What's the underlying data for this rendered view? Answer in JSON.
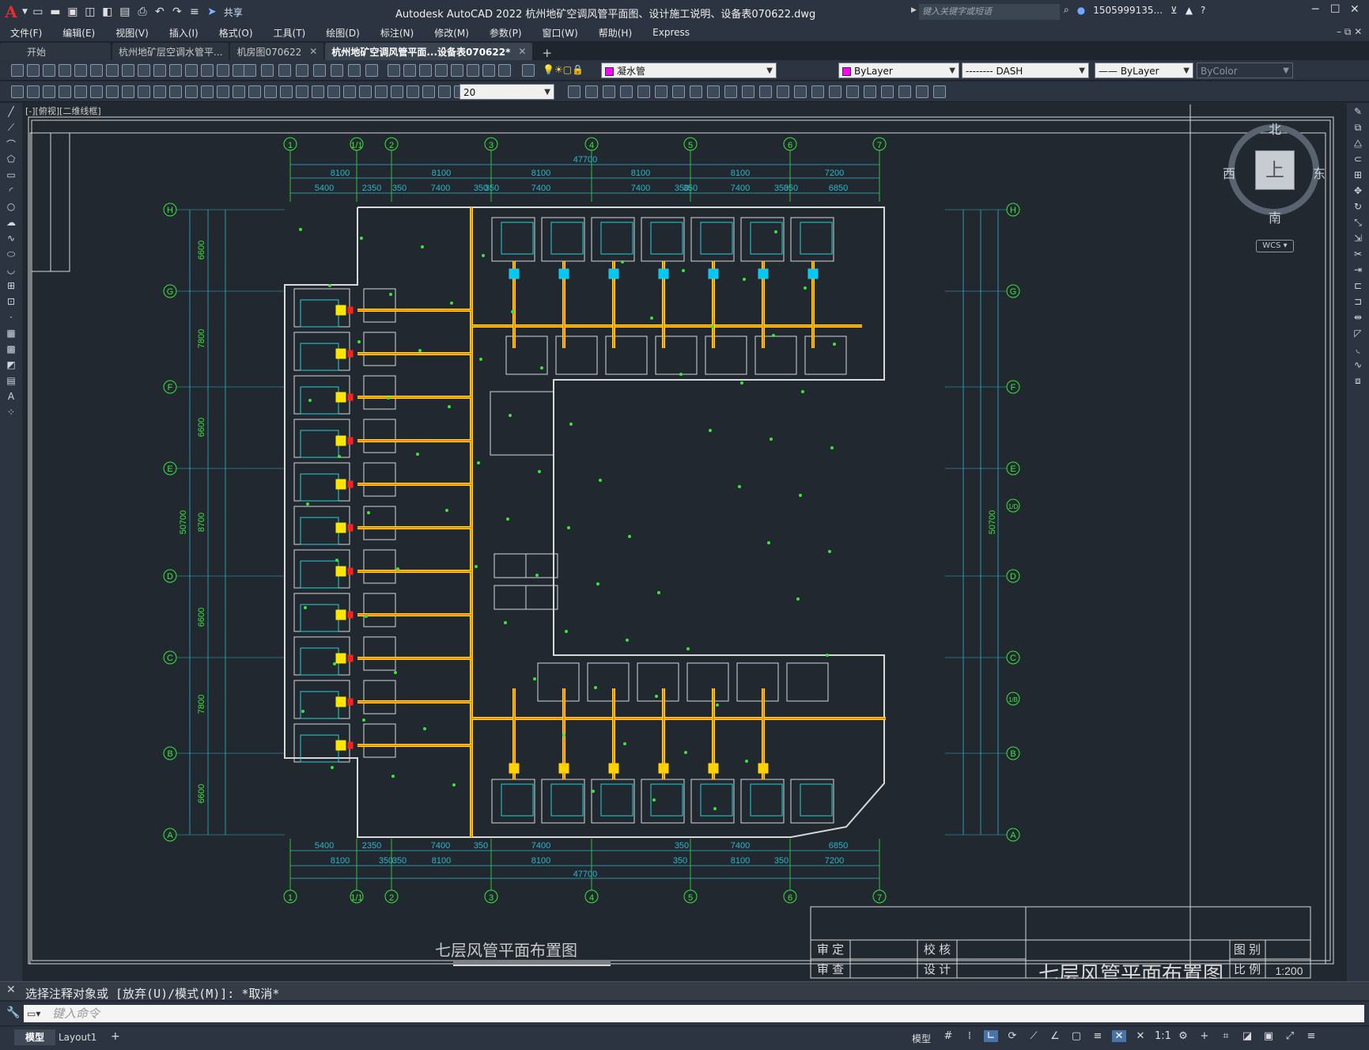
{
  "title_bar": {
    "app_title": "Autodesk AutoCAD 2022    杭州地矿空调风管平面图、设计施工说明、设备表070622.dwg",
    "share_label": "共享",
    "search_placeholder": "键入关键字或短语",
    "user": "1505999135...",
    "logo": "A"
  },
  "menu": [
    "文件(F)",
    "编辑(E)",
    "视图(V)",
    "插入(I)",
    "格式(O)",
    "工具(T)",
    "绘图(D)",
    "标注(N)",
    "修改(M)",
    "参数(P)",
    "窗口(W)",
    "帮助(H)",
    "Express"
  ],
  "tabs": [
    {
      "label": "开始",
      "active": false,
      "closable": false
    },
    {
      "label": "杭州地矿层空调水管平...",
      "active": false,
      "closable": true
    },
    {
      "label": "机房图070622",
      "active": false,
      "closable": true
    },
    {
      "label": "杭州地矿空调风管平面...设备表070622*",
      "active": true,
      "closable": true
    }
  ],
  "layer_toolbar": {
    "layer_name": "凝水管",
    "layer_color": "#ff00ff",
    "color": "ByLayer",
    "linetype": "-------- DASH",
    "lineweight": "—— ByLayer",
    "plotstyle": "ByColor",
    "dimscale": "20"
  },
  "viewport_label": "[-][俯视][二维线框]",
  "viewcube": {
    "north": "北",
    "south": "南",
    "west": "西",
    "east": "东",
    "top": "上",
    "wcs": "WCS"
  },
  "drawing": {
    "grid_top_labels": [
      "1",
      "1/1",
      "2",
      "3",
      "4",
      "5",
      "6",
      "7"
    ],
    "grid_side_left": [
      "H",
      "G",
      "F",
      "E",
      "D",
      "C",
      "B",
      "A"
    ],
    "grid_side_right": [
      "H",
      "G",
      "F",
      "E",
      "1/D",
      "D",
      "C",
      "1/B",
      "B",
      "A"
    ],
    "top_total": "47700",
    "top_dims": [
      "8100",
      "8100",
      "8100",
      "8100",
      "8100",
      "7200"
    ],
    "top_dims2": [
      "5400",
      "2350",
      "350",
      "7400",
      "350",
      "350",
      "7400",
      "7400",
      "350",
      "350",
      "7400",
      "350",
      "350",
      "6850"
    ],
    "bottom_dims": [
      "5400",
      "2350",
      "7400",
      "350",
      "7400",
      "350",
      "7400",
      "6850"
    ],
    "bottom_dims2": [
      "8100",
      "350",
      "350",
      "8100",
      "8100",
      "350",
      "8100",
      "350",
      "7200"
    ],
    "bottom_total": "47700",
    "left_dims": [
      "6600",
      "7800",
      "6600",
      "8700",
      "6600",
      "7800",
      "6600"
    ],
    "left_total": "50700",
    "right_total": "50700",
    "plan_title": "七层风管平面布置图",
    "scale": "1:200",
    "titleblock": {
      "c1": "审  定",
      "c2": "校  核",
      "c3": "审  查",
      "c4": "设  计",
      "r1": "图  别",
      "r2": "比  例",
      "name": "七层风管平面布置图"
    }
  },
  "command": {
    "history": "选择注释对象或 [放弃(U)/模式(M)]: *取消*",
    "input_placeholder": "键入命令"
  },
  "status": {
    "tabs": [
      {
        "label": "模型",
        "active": true
      },
      {
        "label": "Layout1",
        "active": false
      }
    ],
    "mode_label": "模型",
    "annoscale": "1:1"
  }
}
